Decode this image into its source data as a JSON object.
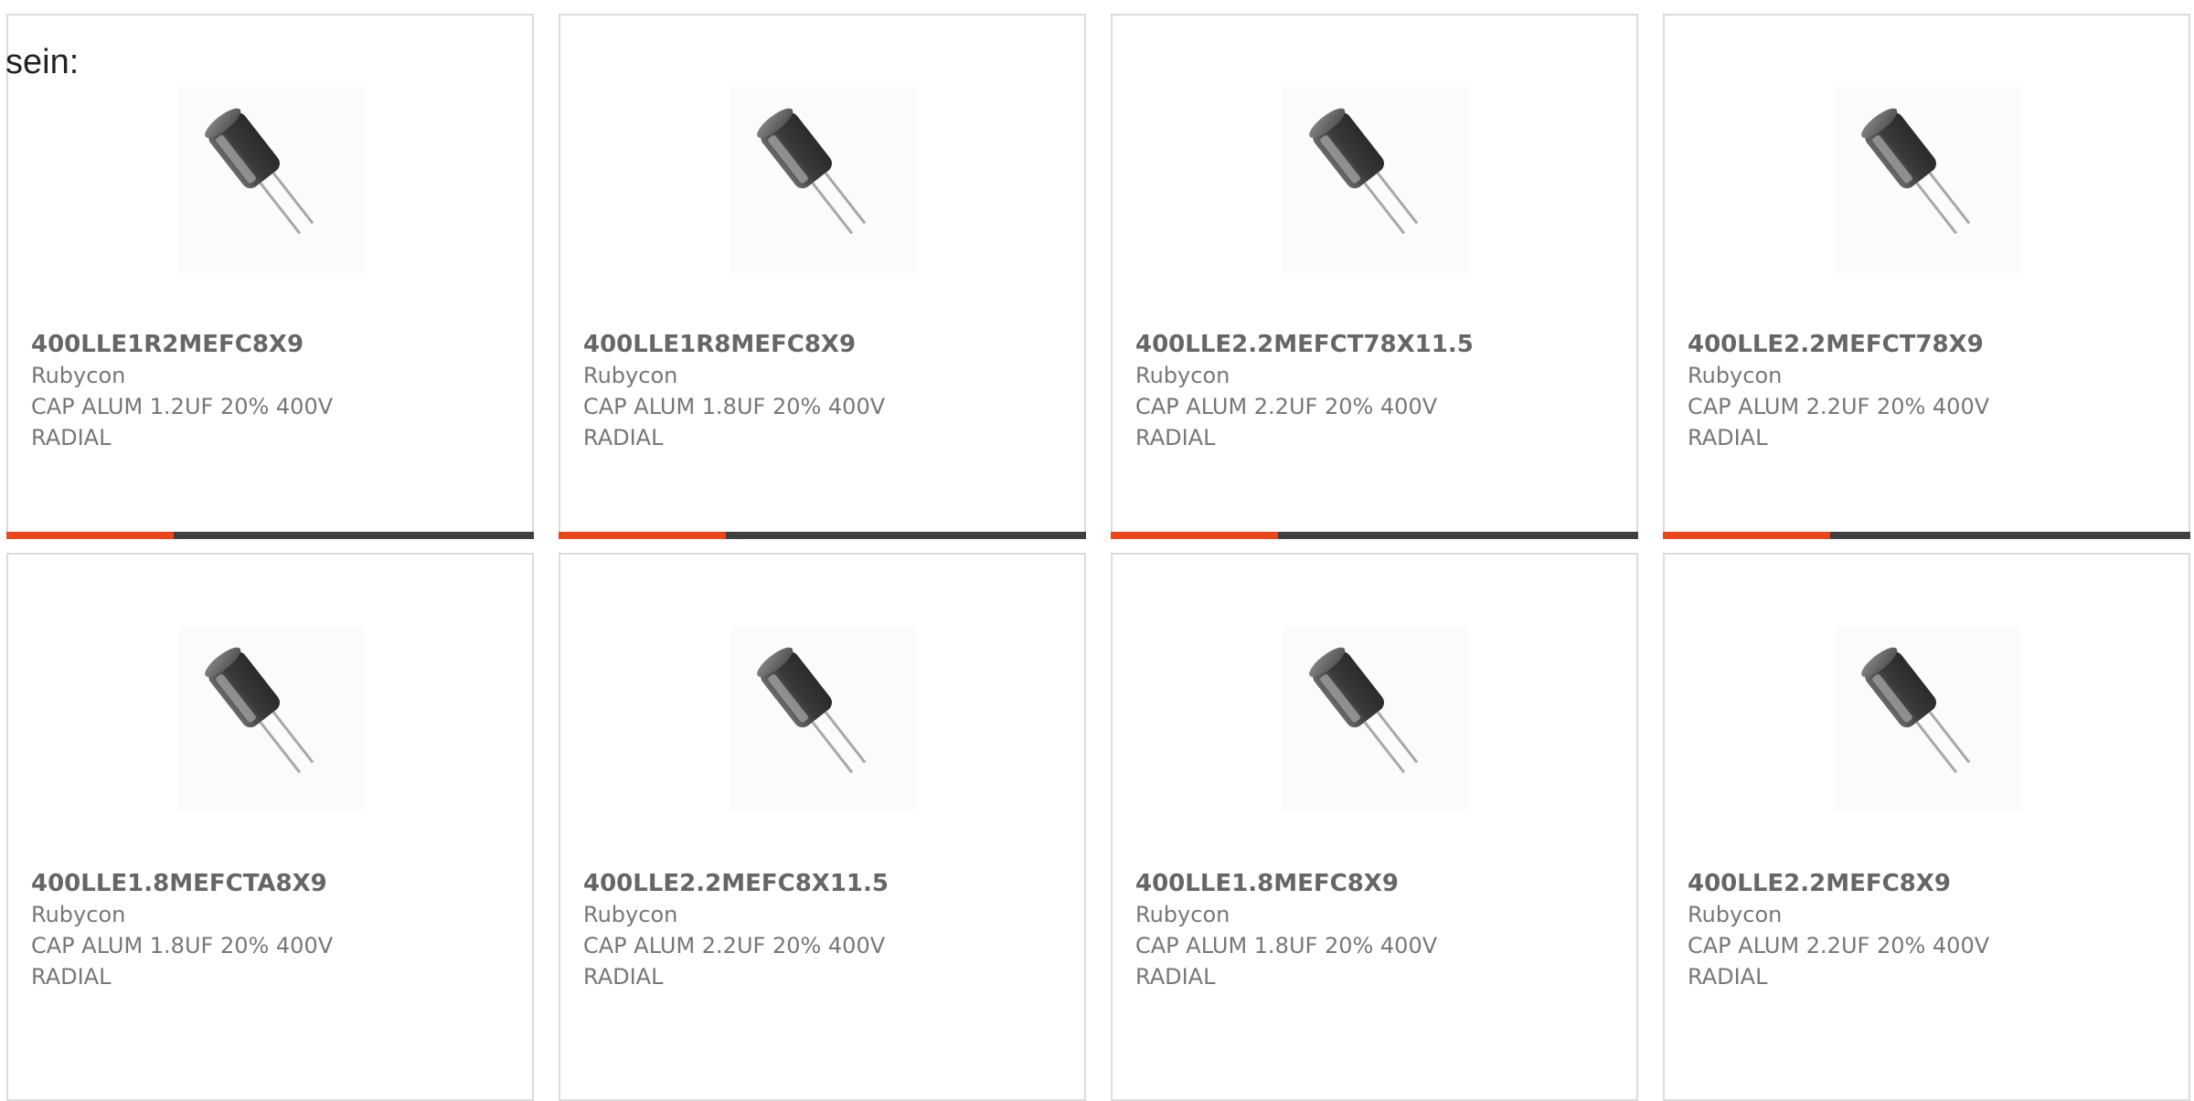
{
  "prefix_text": "sein:",
  "colors": {
    "accent": "#e8461d",
    "bar": "#3f3f3f",
    "border": "#dcdcdc",
    "text": "#666666"
  },
  "products": [
    {
      "icon": "capacitor-image",
      "part_number": "400LLE1R2MEFC8X9",
      "manufacturer": "Rubycon",
      "description": "CAP ALUM 1.2UF 20% 400V RADIAL"
    },
    {
      "icon": "capacitor-image",
      "part_number": "400LLE1R8MEFC8X9",
      "manufacturer": "Rubycon",
      "description": "CAP ALUM 1.8UF 20% 400V RADIAL"
    },
    {
      "icon": "capacitor-image",
      "part_number": "400LLE2.2MEFCT78X11.5",
      "manufacturer": "Rubycon",
      "description": "CAP ALUM 2.2UF 20% 400V RADIAL"
    },
    {
      "icon": "capacitor-image",
      "part_number": "400LLE2.2MEFCT78X9",
      "manufacturer": "Rubycon",
      "description": "CAP ALUM 2.2UF 20% 400V RADIAL"
    },
    {
      "icon": "capacitor-image",
      "part_number": "400LLE1.8MEFCTA8X9",
      "manufacturer": "Rubycon",
      "description": "CAP ALUM 1.8UF 20% 400V RADIAL"
    },
    {
      "icon": "capacitor-image",
      "part_number": "400LLE2.2MEFC8X11.5",
      "manufacturer": "Rubycon",
      "description": "CAP ALUM 2.2UF 20% 400V RADIAL"
    },
    {
      "icon": "capacitor-image",
      "part_number": "400LLE1.8MEFC8X9",
      "manufacturer": "Rubycon",
      "description": "CAP ALUM 1.8UF 20% 400V RADIAL"
    },
    {
      "icon": "capacitor-image",
      "part_number": "400LLE2.2MEFC8X9",
      "manufacturer": "Rubycon",
      "description": "CAP ALUM 2.2UF 20% 400V RADIAL"
    }
  ]
}
